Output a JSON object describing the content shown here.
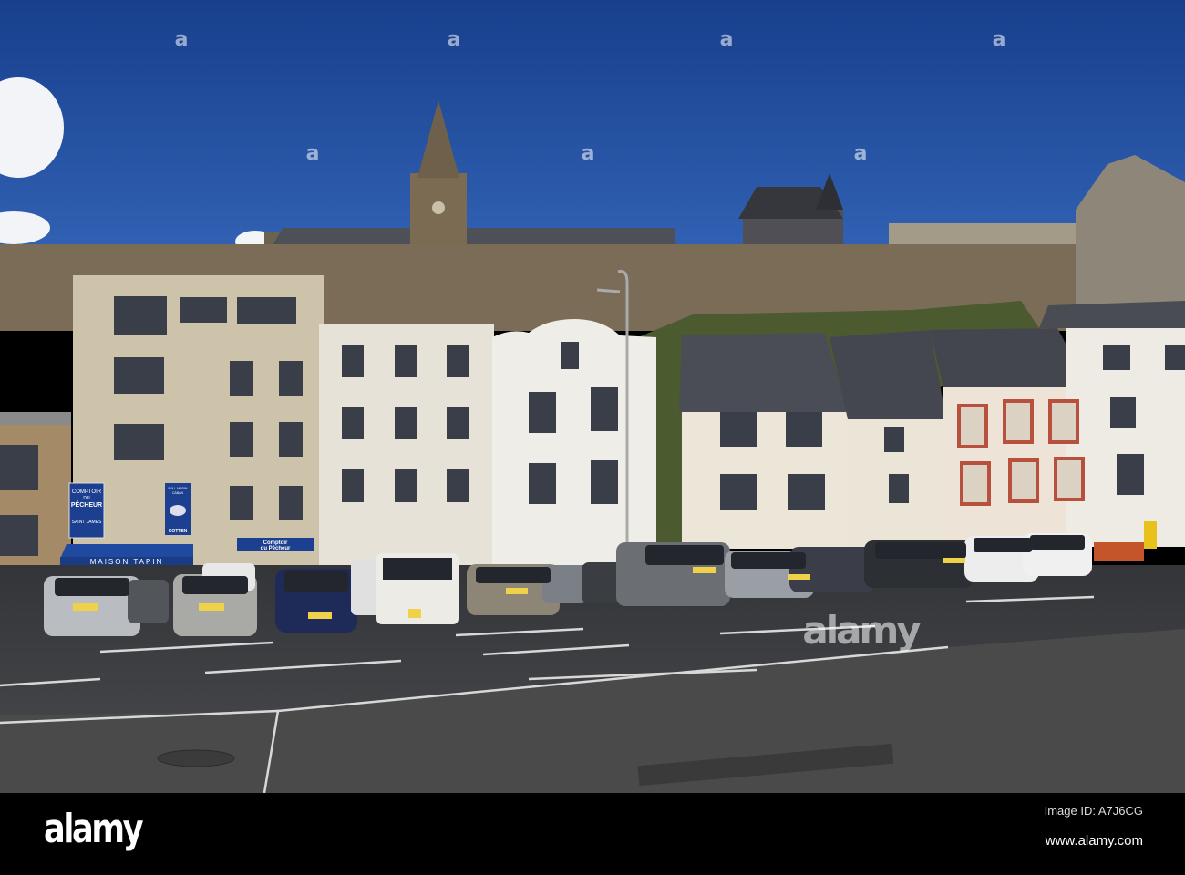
{
  "photo": {
    "signs": {
      "comptoir_vertical": [
        "COMPTOIR",
        "DU",
        "PÊCHEUR",
        "SAINT JAMES"
      ],
      "cotten_sign": [
        "PULL MARIN",
        "CABAN",
        "COTTEN"
      ],
      "maison_tapin": "MAISON TAPIN",
      "comptoir_horizontal": [
        "Comptoir",
        "du Pêcheur"
      ]
    },
    "watermark": "alamy"
  },
  "footer": {
    "logo": "alamy",
    "image_id": "Image ID: A7J6CG",
    "website": "www.alamy.com"
  },
  "colors": {
    "sky": "#1f4c9c",
    "road": "#3c3e42",
    "sign_blue": "#1d3f8f"
  }
}
